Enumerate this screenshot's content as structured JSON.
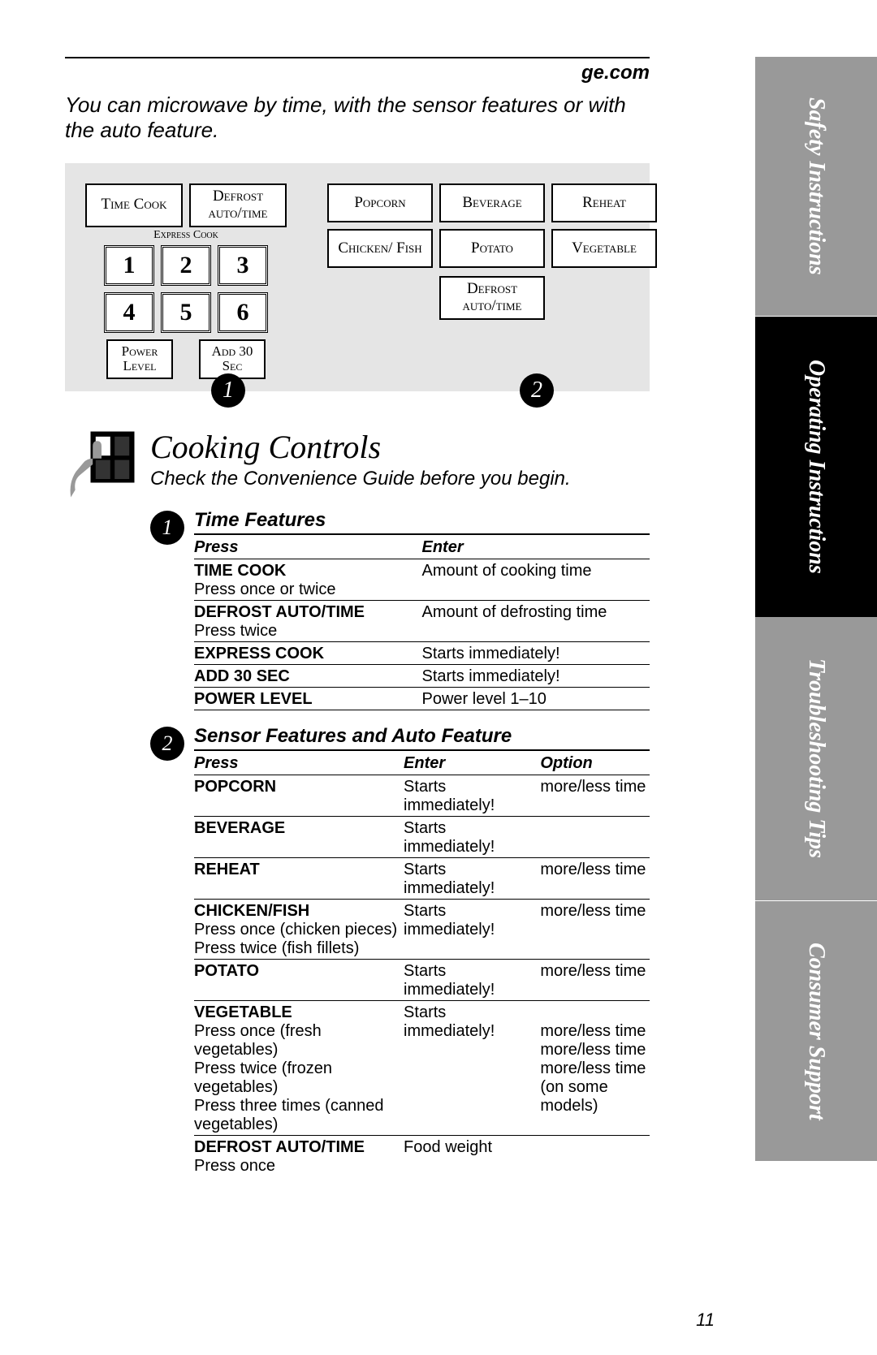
{
  "website": "ge.com",
  "intro": "You can microwave by time, with the sensor features or with the auto feature.",
  "panel": {
    "time_cook": "Time Cook",
    "defrost_auto": "Defrost auto/time",
    "express_label": "Express Cook",
    "nums": [
      "1",
      "2",
      "3",
      "4",
      "5",
      "6"
    ],
    "power_level": "Power Level",
    "add_30": "Add 30 Sec",
    "popcorn": "Popcorn",
    "beverage": "Beverage",
    "reheat": "Reheat",
    "chicken_fish": "Chicken/ Fish",
    "potato": "Potato",
    "vegetable": "Vegetable",
    "defrost_auto2": "Defrost auto/time",
    "callout1": "1",
    "callout2": "2"
  },
  "section": {
    "title": "Cooking Controls",
    "sub": "Check the Convenience Guide before you begin."
  },
  "feature1": {
    "num": "1",
    "title": "Time Features",
    "head_press": "Press",
    "head_enter": "Enter",
    "rows": [
      {
        "press": "TIME COOK",
        "sub": "Press once or twice",
        "enter": "Amount of cooking time"
      },
      {
        "press": "DEFROST AUTO/TIME",
        "sub": "Press twice",
        "enter": "Amount of defrosting time"
      },
      {
        "press": "EXPRESS COOK",
        "sub": "",
        "enter": "Starts immediately!"
      },
      {
        "press": "ADD 30 SEC",
        "sub": "",
        "enter": "Starts immediately!"
      },
      {
        "press": "POWER LEVEL",
        "sub": "",
        "enter": "Power level 1–10"
      }
    ]
  },
  "feature2": {
    "num": "2",
    "title": "Sensor Features and Auto Feature",
    "head_press": "Press",
    "head_enter": "Enter",
    "head_option": "Option",
    "popcorn_p": "POPCORN",
    "popcorn_e": "Starts immediately!",
    "popcorn_o": "more/less time",
    "beverage_p": "BEVERAGE",
    "beverage_e": "Starts immediately!",
    "reheat_p": "REHEAT",
    "reheat_e": "Starts immediately!",
    "reheat_o": "more/less time",
    "chicken_p": "CHICKEN/FISH",
    "chicken_s1": "Press once (chicken pieces)",
    "chicken_s2": "Press twice (fish fillets)",
    "chicken_e": "Starts immediately!",
    "chicken_o": "more/less time",
    "potato_p": "POTATO",
    "potato_e": "Starts immediately!",
    "potato_o": "more/less time",
    "veg_p": "VEGETABLE",
    "veg_e": "Starts immediately!",
    "veg_s1": "Press once (fresh vegetables)",
    "veg_o1": "more/less time",
    "veg_s2": "Press twice (frozen vegetables)",
    "veg_o2": "more/less time",
    "veg_s3": "Press three times (canned vegetables)",
    "veg_o3": "more/less time",
    "veg_o4": "(on some models)",
    "defrost_p": "DEFROST AUTO/TIME",
    "defrost_s": "Press once",
    "defrost_e": "Food weight"
  },
  "tabs": {
    "safety": "Safety Instructions",
    "operating": "Operating Instructions",
    "troubleshooting": "Troubleshooting Tips",
    "consumer": "Consumer Support"
  },
  "pagenum": "11"
}
